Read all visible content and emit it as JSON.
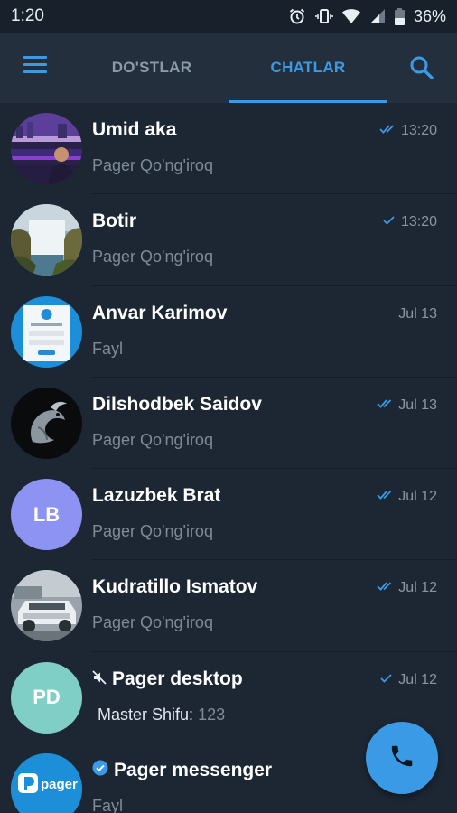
{
  "status_bar": {
    "time": "1:20",
    "battery": "36%"
  },
  "header": {
    "tabs": [
      {
        "label": "DO'STLAR"
      },
      {
        "label": "CHATLAR"
      }
    ],
    "accent_color": "#3a9ae6"
  },
  "chats": [
    {
      "name": "Umid aka",
      "time": "13:20",
      "preview": "Pager Qo'ng'iroq",
      "status": "read"
    },
    {
      "name": "Botir",
      "time": "13:20",
      "preview": "Pager Qo'ng'iroq",
      "status": "sent"
    },
    {
      "name": "Anvar Karimov",
      "time": "Jul 13",
      "preview": "Fayl",
      "status": "none"
    },
    {
      "name": "Dilshodbek Saidov",
      "time": "Jul 13",
      "preview": "Pager Qo'ng'iroq",
      "status": "read"
    },
    {
      "name": "Lazuzbek Brat",
      "time": "Jul 12",
      "preview": "Pager Qo'ng'iroq",
      "status": "read",
      "initials": "LB",
      "avatar_color": "#8c93f2"
    },
    {
      "name": "Kudratillo Ismatov",
      "time": "Jul 12",
      "preview": "Pager Qo'ng'iroq",
      "status": "read"
    },
    {
      "name": "Pager desktop",
      "time": "Jul 12",
      "sender": "Master Shifu:",
      "preview": "123",
      "status": "sent",
      "initials": "PD",
      "avatar_color": "#7fcfc6",
      "muted": true
    },
    {
      "name": "Pager messenger",
      "time": "",
      "preview": "Fayl",
      "verified": true,
      "avatar_text": "pager"
    }
  ]
}
